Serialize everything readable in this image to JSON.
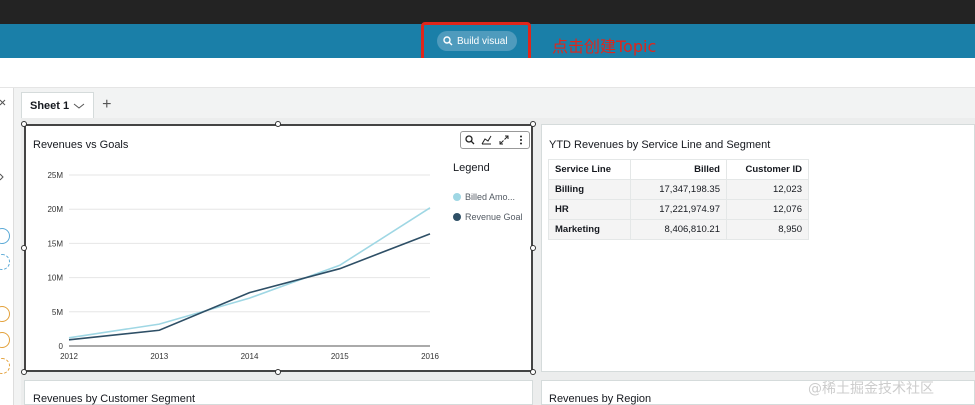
{
  "header": {
    "build_visual_label": "Build visual",
    "annotation_text": "点击创建Topic"
  },
  "tabs": [
    {
      "label": "Sheet 1"
    }
  ],
  "visuals": {
    "revenues_vs_goals": {
      "title": "Revenues vs Goals",
      "legend_title": "Legend",
      "legend_items": [
        "Billed Amo...",
        "Revenue Goal"
      ]
    },
    "ytd_revenues": {
      "title": "YTD Revenues by Service Line and Segment",
      "columns": [
        "Service Line",
        "Billed",
        "Customer ID"
      ],
      "rows": [
        [
          "Billing",
          "17,347,198.35",
          "12,023"
        ],
        [
          "HR",
          "17,221,974.97",
          "12,076"
        ],
        [
          "Marketing",
          "8,406,810.21",
          "8,950"
        ]
      ]
    },
    "revenues_by_customer_segment": {
      "title": "Revenues by Customer Segment"
    },
    "revenues_by_region": {
      "title": "Revenues by Region"
    }
  },
  "watermark": "@稀土掘金技术社区",
  "colors": {
    "billed": "#9fd7e4",
    "goal": "#2e4f66",
    "annotation": "#e0261b"
  },
  "chart_data": {
    "type": "line",
    "title": "Revenues vs Goals",
    "x": [
      "2012",
      "2013",
      "2014",
      "2015",
      "2016"
    ],
    "y_ticks": [
      "0",
      "5M",
      "10M",
      "15M",
      "20M",
      "25M"
    ],
    "ylim": [
      0,
      25
    ],
    "series": [
      {
        "name": "Billed Amo...",
        "values": [
          1.2,
          3.2,
          7.0,
          11.8,
          20.2
        ]
      },
      {
        "name": "Revenue Goal",
        "values": [
          0.9,
          2.3,
          7.8,
          11.3,
          16.4
        ]
      }
    ],
    "legend": "right",
    "grid": true
  }
}
